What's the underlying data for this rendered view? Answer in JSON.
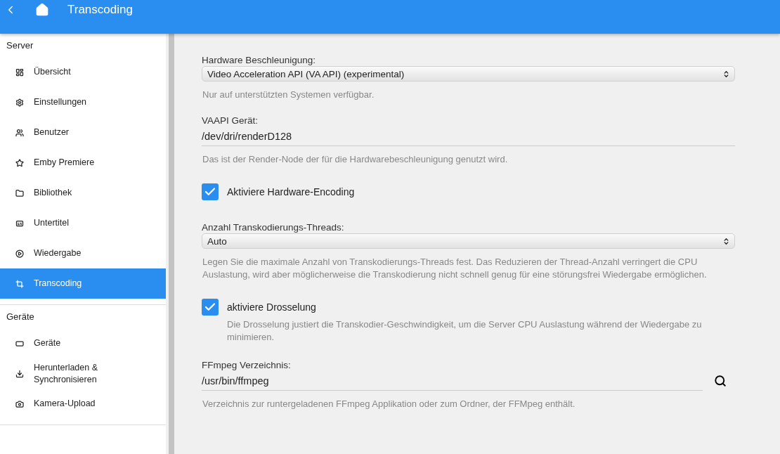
{
  "header": {
    "title": "Transcoding"
  },
  "sidebar": {
    "sections": [
      {
        "title": "Server",
        "items": [
          {
            "label": "Übersicht",
            "selected": false
          },
          {
            "label": "Einstellungen",
            "selected": false
          },
          {
            "label": "Benutzer",
            "selected": false
          },
          {
            "label": "Emby Premiere",
            "selected": false
          },
          {
            "label": "Bibliothek",
            "selected": false
          },
          {
            "label": "Untertitel",
            "selected": false
          },
          {
            "label": "Wiedergabe",
            "selected": false
          },
          {
            "label": "Transcoding",
            "selected": true
          }
        ]
      },
      {
        "title": "Geräte",
        "items": [
          {
            "label": "Geräte",
            "selected": false
          },
          {
            "label": "Herunterladen & Synchronisieren",
            "selected": false
          },
          {
            "label": "Kamera-Upload",
            "selected": false
          }
        ]
      }
    ]
  },
  "form": [
    {
      "kind": "select",
      "label": "Hardware Beschleunigung:",
      "value": "Video Acceleration API (VA API) (experimental)",
      "help": "Nur auf unterstützten Systemen verfügbar."
    },
    {
      "kind": "text",
      "label": "VAAPI Gerät:",
      "value": "/dev/dri/renderD128",
      "help": "Das ist der Render-Node der für die Hardwarebeschleunigung genutzt wird."
    },
    {
      "kind": "checkbox",
      "label": "Aktiviere Hardware-Encoding",
      "checked": true
    },
    {
      "kind": "select",
      "label": "Anzahl Transkodierungs-Threads:",
      "value": "Auto",
      "help": "Legen Sie die maximale Anzahl von Transkodierungs-Threads fest. Das Reduzieren der Thread-Anzahl verringert die CPU Auslastung, wird aber möglicherweise die Transkodierung nicht schnell genug für eine störungsfrei Wiedergabe ermöglichen."
    },
    {
      "kind": "checkbox",
      "label": "aktiviere Drosselung",
      "checked": true,
      "help": "Die Drosselung justiert die Transkodier-Geschwindigkeit, um die Server CPU Auslastung während der Wiedergabe zu minimieren."
    },
    {
      "kind": "path",
      "label": "FFmpeg Verzeichnis:",
      "value": "/usr/bin/ffmpeg",
      "help": "Verzeichnis zur runtergeladenen FFmpeg Applikation oder zum Ordner, der FFMpeg enthält."
    }
  ]
}
